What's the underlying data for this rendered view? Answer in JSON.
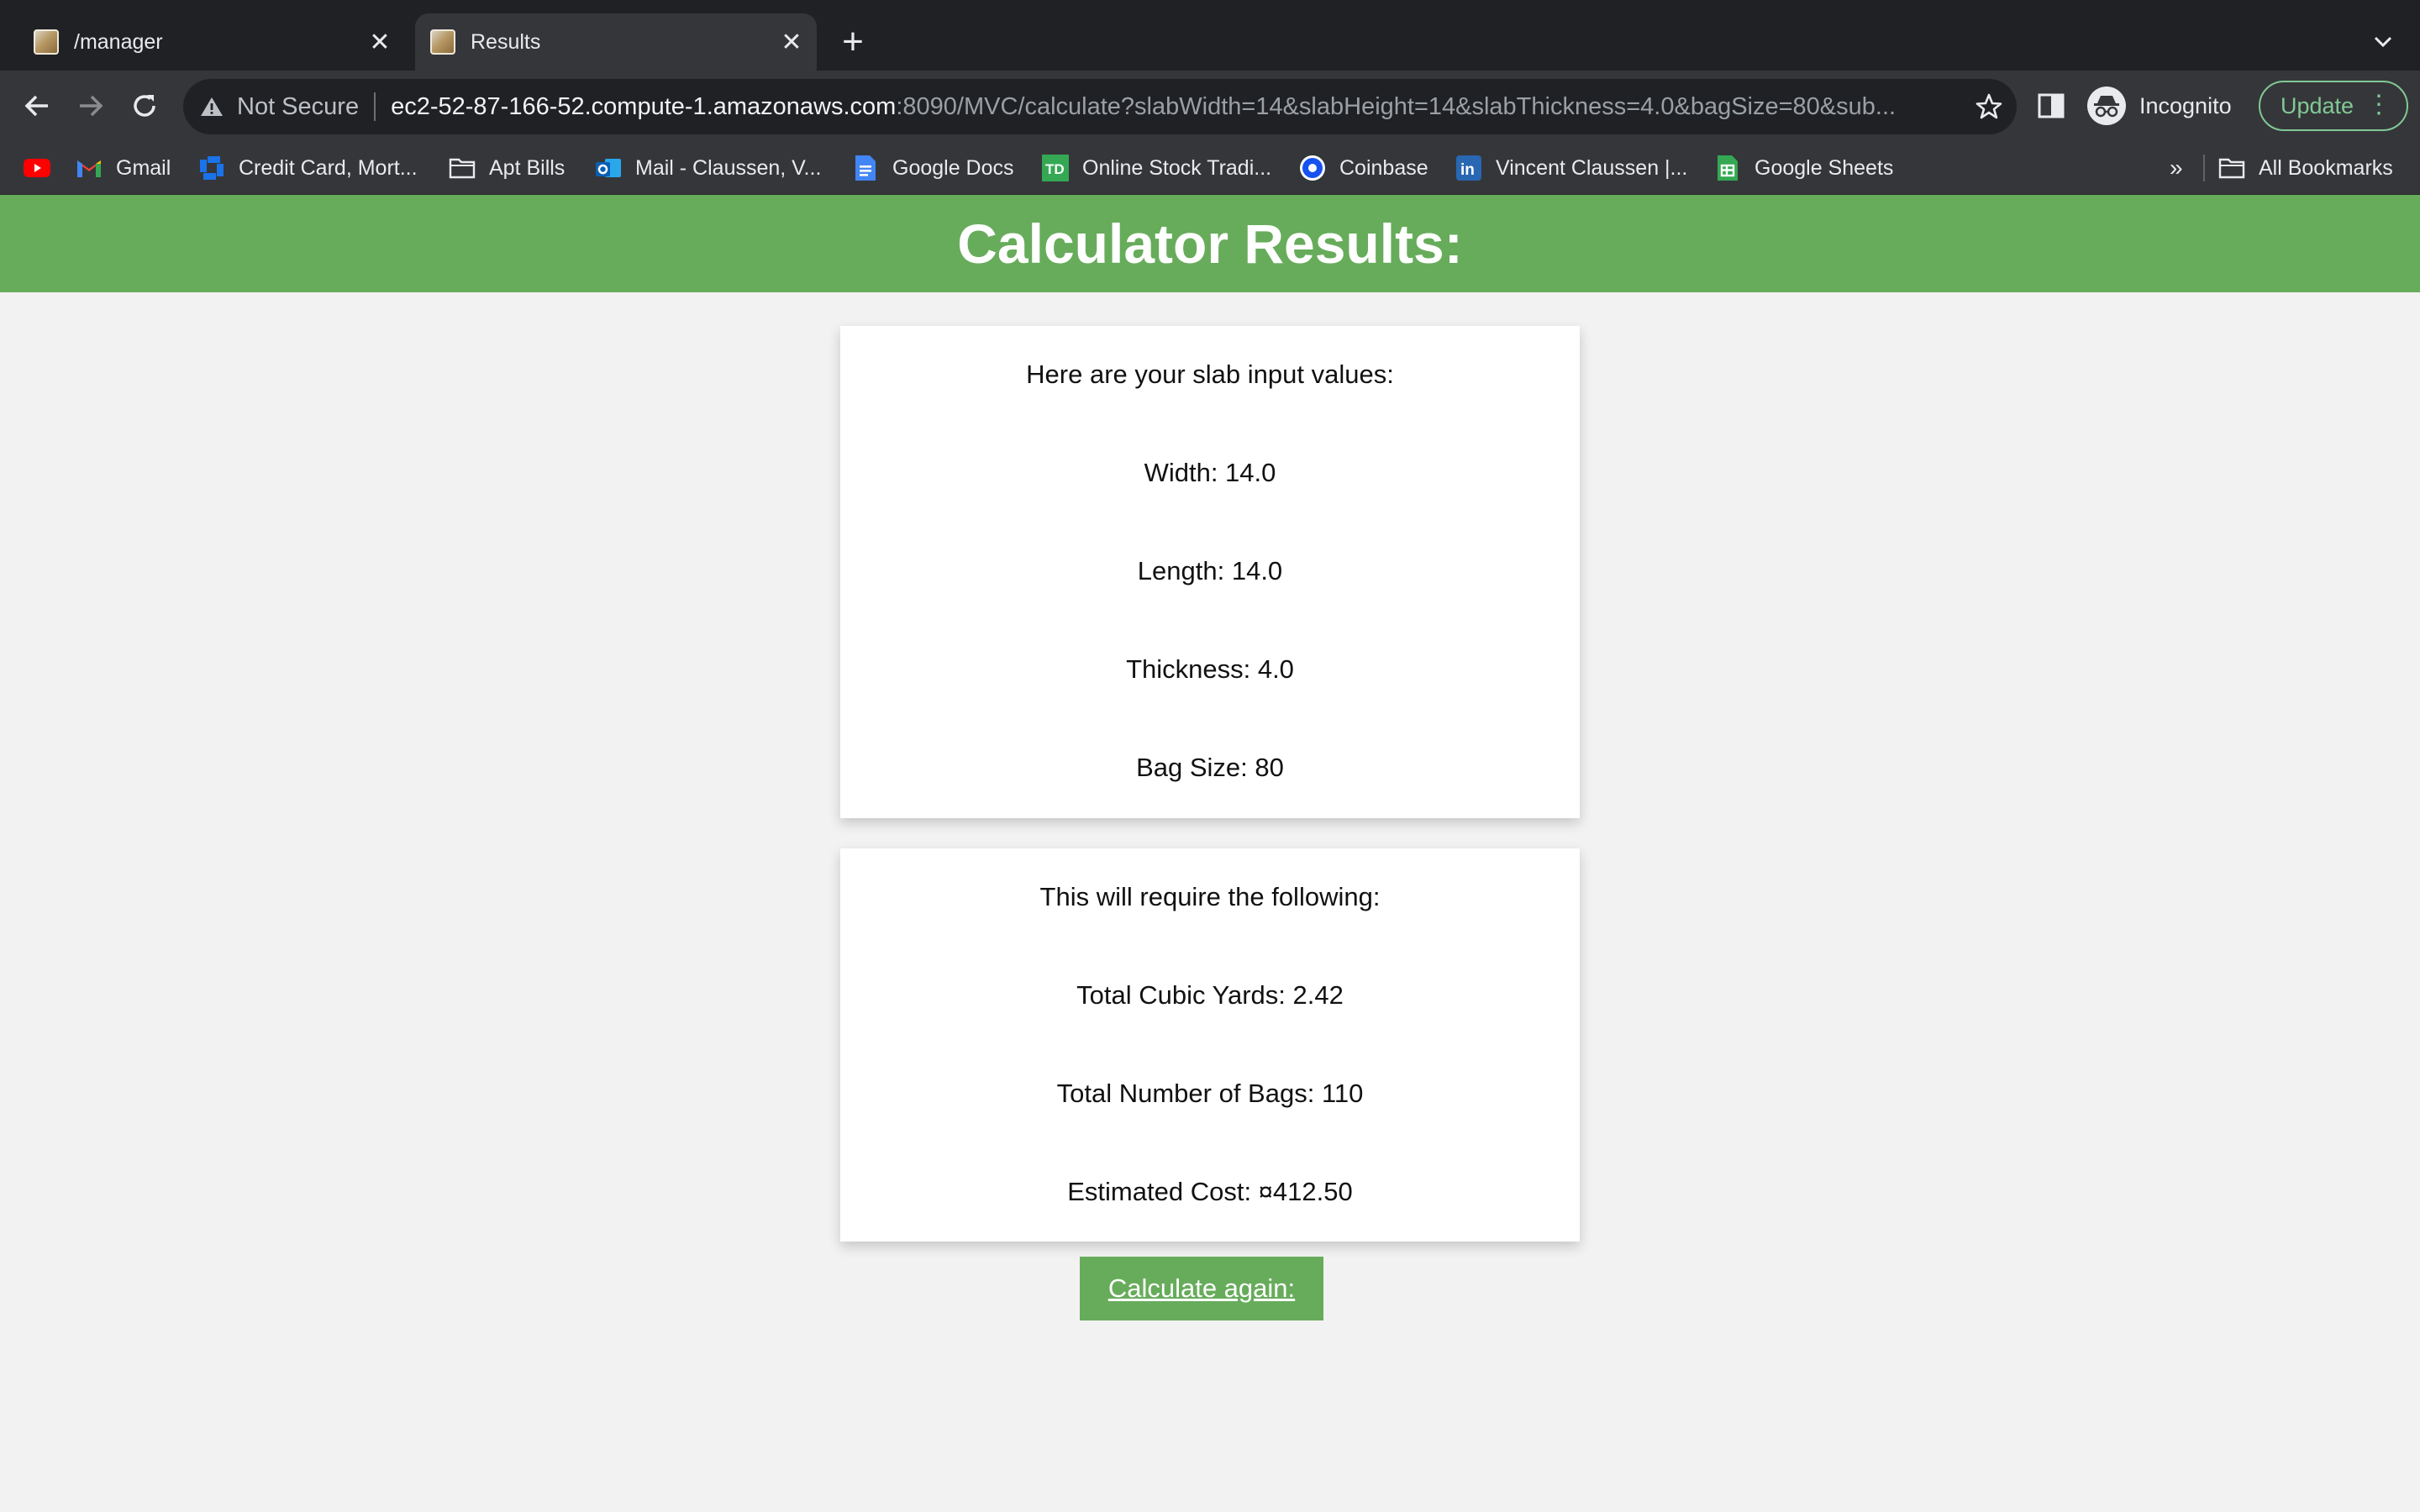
{
  "tabs": [
    {
      "title": "/manager",
      "active": false
    },
    {
      "title": "Results",
      "active": true
    }
  ],
  "toolbar": {
    "security_label": "Not Secure",
    "url_host": "ec2-52-87-166-52.compute-1.amazonaws.com",
    "url_rest": ":8090/MVC/calculate?slabWidth=14&slabHeight=14&slabThickness=4.0&bagSize=80&sub...",
    "profile_label": "Incognito",
    "update_label": "Update"
  },
  "bookmarks": [
    {
      "label": "",
      "icon": "youtube-icon"
    },
    {
      "label": "Gmail",
      "icon": "gmail-icon"
    },
    {
      "label": "Credit Card, Mort...",
      "icon": "chase-icon"
    },
    {
      "label": "Apt Bills",
      "icon": "folder-icon"
    },
    {
      "label": "Mail - Claussen, V...",
      "icon": "outlook-icon"
    },
    {
      "label": "Google Docs",
      "icon": "docs-icon"
    },
    {
      "label": "Online Stock Tradi...",
      "icon": "td-icon"
    },
    {
      "label": "Coinbase",
      "icon": "coinbase-icon"
    },
    {
      "label": "Vincent Claussen |...",
      "icon": "linkedin-icon"
    },
    {
      "label": "Google Sheets",
      "icon": "sheets-icon"
    }
  ],
  "bookmarks_more": "»",
  "all_bookmarks_label": "All Bookmarks",
  "page": {
    "title": "Calculator Results:",
    "inputs_card": {
      "heading": "Here are your slab input values:",
      "width": "Width: 14.0",
      "length": "Length: 14.0",
      "thickness": "Thickness: 4.0",
      "bag_size": "Bag Size: 80"
    },
    "results_card": {
      "heading": "This will require the following:",
      "cubic_yards": "Total Cubic Yards: 2.42",
      "bags": "Total Number of Bags: 110",
      "cost": "Estimated Cost: ¤412.50"
    },
    "calculate_again": "Calculate again:"
  },
  "colors": {
    "header_green": "#67ac5b",
    "button_green": "#67ac5b",
    "page_bg": "#f2f2f2",
    "chrome_dark": "#202124",
    "toolbar": "#35363a"
  }
}
